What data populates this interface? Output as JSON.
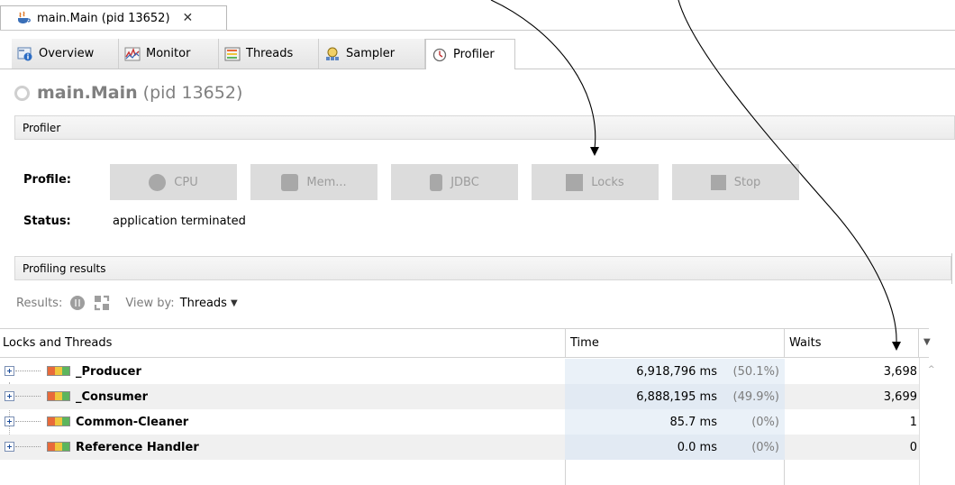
{
  "document_tab": {
    "title": "main.Main (pid 13652)",
    "close_glyph": "✕",
    "icon": "java-cup-icon"
  },
  "tabs": [
    {
      "label": "Overview",
      "icon": "overview-icon"
    },
    {
      "label": "Monitor",
      "icon": "monitor-icon"
    },
    {
      "label": "Threads",
      "icon": "threads-icon"
    },
    {
      "label": "Sampler",
      "icon": "sampler-icon"
    },
    {
      "label": "Profiler",
      "icon": "profiler-icon",
      "active": true
    }
  ],
  "header": {
    "app_name": "main.Main",
    "pid_text": "(pid 13652)"
  },
  "profiler_section": {
    "title": "Profiler",
    "profile_label": "Profile:",
    "buttons": [
      {
        "label": "CPU",
        "icon": "cpu-icon"
      },
      {
        "label": "Mem...",
        "icon": "memory-icon"
      },
      {
        "label": "JDBC",
        "icon": "jdbc-icon"
      },
      {
        "label": "Locks",
        "icon": "locks-icon"
      },
      {
        "label": "Stop",
        "icon": "stop-icon"
      }
    ],
    "status_label": "Status:",
    "status_value": "application terminated"
  },
  "results_section": {
    "title": "Profiling results",
    "results_label": "Results:",
    "view_by_label": "View by:",
    "view_by_value": "Threads"
  },
  "table": {
    "columns": [
      "Locks and Threads",
      "Time",
      "Waits"
    ],
    "rows": [
      {
        "name": "_Producer",
        "time": "6,918,796 ms",
        "pct": "(50.1%)",
        "waits": "3,698"
      },
      {
        "name": "_Consumer",
        "time": "6,888,195 ms",
        "pct": "(49.9%)",
        "waits": "3,699"
      },
      {
        "name": "Common-Cleaner",
        "time": "85.7 ms",
        "pct": "(0%)",
        "waits": "1"
      },
      {
        "name": "Reference Handler",
        "time": "0.0 ms",
        "pct": "(0%)",
        "waits": "0"
      }
    ]
  },
  "colors": {
    "accent_blue": "#1d4d9b",
    "disabled_button": "#dcdcdc",
    "time_column_bg": "#eaf1f8"
  }
}
